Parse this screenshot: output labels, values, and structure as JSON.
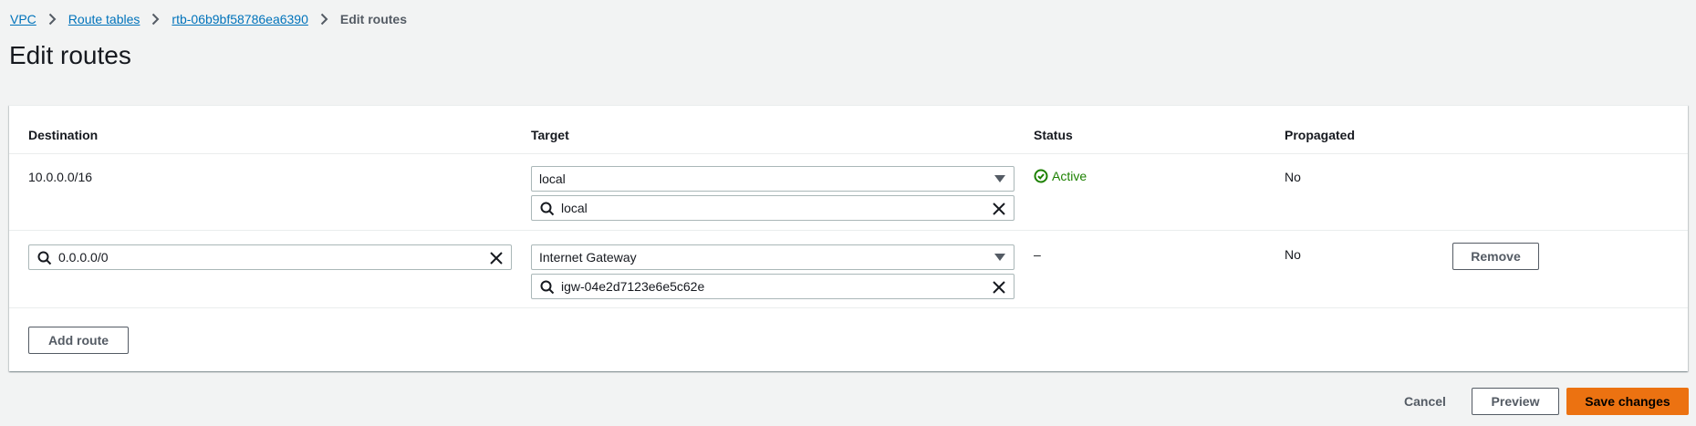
{
  "breadcrumb": {
    "items": [
      "VPC",
      "Route tables",
      "rtb-06b9bf58786ea6390"
    ],
    "current": "Edit routes"
  },
  "page": {
    "title": "Edit routes"
  },
  "table": {
    "headers": {
      "destination": "Destination",
      "target": "Target",
      "status": "Status",
      "propagated": "Propagated"
    },
    "rows": [
      {
        "destination": "10.0.0.0/16",
        "target_type": "local",
        "target_value": "local",
        "status": "Active",
        "propagated": "No"
      },
      {
        "destination": "0.0.0.0/0",
        "target_type": "Internet Gateway",
        "target_value": "igw-04e2d7123e6e5c62e",
        "status": "–",
        "propagated": "No",
        "remove_label": "Remove"
      }
    ],
    "add_route_label": "Add route"
  },
  "footer": {
    "cancel_label": "Cancel",
    "preview_label": "Preview",
    "save_label": "Save changes"
  },
  "colors": {
    "link": "#0073bb",
    "active": "#1d8102",
    "primary": "#ec7211",
    "background": "#f2f3f3"
  },
  "icons": [
    "chevron-right-icon",
    "caret-down-icon",
    "search-icon",
    "clear-icon",
    "check-circle-icon"
  ]
}
